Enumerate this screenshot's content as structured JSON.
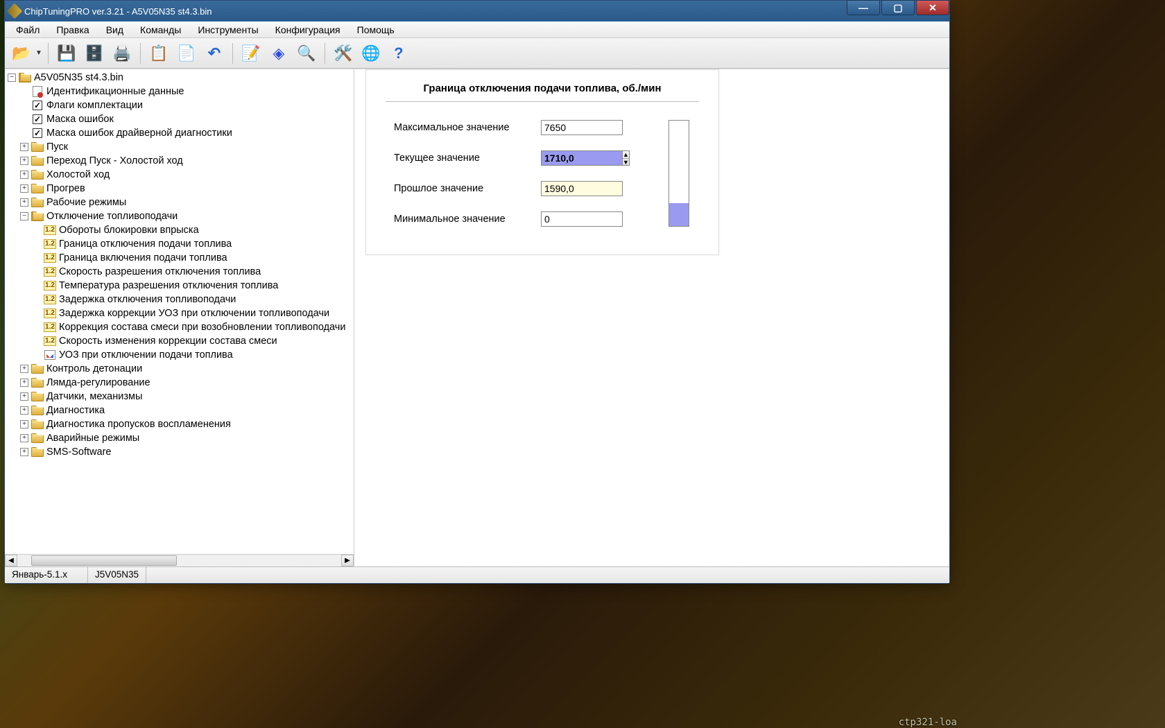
{
  "title": "ChipTuningPRO ver.3.21 - A5V05N35 st4.3.bin",
  "menu": [
    "Файл",
    "Правка",
    "Вид",
    "Команды",
    "Инструменты",
    "Конфигурация",
    "Помощь"
  ],
  "toolbar_icons": [
    "open",
    "save",
    "save-copy",
    "print",
    "copy",
    "paste",
    "undo",
    "edit-doc",
    "info",
    "search",
    "tool-wrench",
    "network",
    "help"
  ],
  "tree": {
    "root": "A5V05N35 st4.3.bin",
    "ident": "Идентификационные данные",
    "flags": "Флаги комплектации",
    "mask": "Маска ошибок",
    "mask_drv": "Маска ошибок драйверной диагностики",
    "folders1": [
      "Пуск",
      "Переход Пуск - Холостой ход",
      "Холостой ход",
      "Прогрев",
      "Рабочие режимы"
    ],
    "fuel_cut": "Отключение топливоподачи",
    "fuel_params": [
      "Обороты блокировки впрыска",
      "Граница отключения подачи топлива",
      "Граница включения подачи топлива",
      "Скорость разрешения отключения топлива",
      "Температура разрешения отключения топлива",
      "Задержка отключения топливоподачи",
      "Задержка коррекции УОЗ при отключении топливоподачи",
      "Коррекция состава смеси при возобновлении топливоподачи",
      "Скорость изменения коррекции состава смеси"
    ],
    "fuel_last": "УОЗ при отключении подачи топлива",
    "folders2": [
      "Контроль детонации",
      "Лямда-регулирование",
      "Датчики, механизмы",
      "Диагностика",
      "Диагностика пропусков воспламенения",
      "Аварийные режимы",
      "SMS-Software"
    ]
  },
  "panel": {
    "title": "Граница отключения подачи топлива, об./мин",
    "rows": {
      "max_label": "Максимальное значение",
      "max_value": "7650",
      "cur_label": "Текущее значение",
      "cur_value": "1710,0",
      "past_label": "Прошлое значение",
      "past_value": "1590,0",
      "min_label": "Минимальное значение",
      "min_value": "0"
    }
  },
  "status": {
    "left": "Январь-5.1.x",
    "mid": "J5V05N35"
  },
  "bg_file": "ctp321-loa"
}
